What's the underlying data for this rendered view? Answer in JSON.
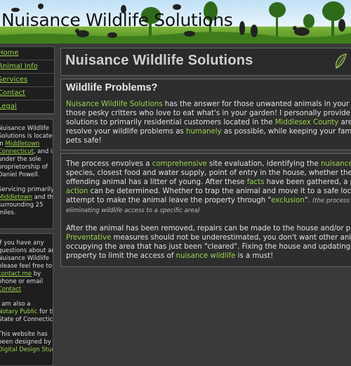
{
  "banner": {
    "title": "Nuisance Wildlife Solutions"
  },
  "nav": {
    "items": [
      {
        "label": "Home"
      },
      {
        "label": "Animal Info"
      },
      {
        "label": "Services"
      },
      {
        "label": "Contact"
      },
      {
        "label": "Legal"
      }
    ]
  },
  "sidebar": {
    "about": {
      "l1a": "Nuisance Wildlife",
      "l2a": "Solutions is located",
      "l3a": "in ",
      "l3b": "Middletown",
      "l4a": "Connecticut",
      "l4b": ", and is",
      "l5a": "under the sole",
      "l6a": "proprietorship of",
      "l7a": "Daniel Powell.",
      "m1": "Servicing primarily",
      "m2a": "Middletown",
      "m2b": " and the",
      "m3": "surrounding 25",
      "m4": "miles."
    },
    "contact": {
      "l1": "If you have any",
      "l2": "questions about any",
      "l3": "Nuisance Wildlife",
      "l4": "please feel free to",
      "l5a": "contact me",
      "l5b": " by",
      "l6": "phone or email",
      "l7": "Contact",
      "n1": "I am also a",
      "n2a": "Notary Public",
      "n2b": " for the",
      "n3": "State of Connecticut.",
      "d1": "This website has",
      "d2": "been designed by",
      "d3": "Digital Design Studio"
    }
  },
  "main": {
    "page_title": "Nuisance Wildlife Solutions",
    "section1": {
      "heading": "Wildlife Problems?",
      "p1_link1": "Nuisance Wildlife Solutions",
      "p1_t1": " has the answer for those unwanted animals in your house,",
      "p1_t2": "those pesky critters who love to eat what's in your garden! I personally provide",
      "p1_t3": "solutions to primarily residential customers located in the ",
      "p1_link2": "Middlesex County",
      "p1_t4": " area. I",
      "p1_t5": "resolve your wildlife problems as ",
      "p1_link3": "humanely",
      "p1_t6": " as possible, while keeping your family and",
      "p1_t7": "pets safe!"
    },
    "section2": {
      "a1": "The process envolves a ",
      "a1_link": "comprehensive",
      "a2": " site evaluation, identifying the ",
      "a2_link": "nuisance wildlife",
      "b1": "species, closest food and water supply, point of entry in the house, whether the",
      "c1": "offending animal has a litter of young. After these ",
      "c1_link": "facts",
      "c2": " have been gathered, a plan of",
      "d1_link": "action",
      "d2": " can be determined. Whether to trap the animal and move it to a safe location or",
      "e1": "attempt to make the animal leave the property through \"",
      "e1_link": "exclusion",
      "e2": "\". ",
      "e3_note": "(the process of",
      "f1_note": "eliminating wildlife access to a specific area)",
      "g1": "After the animal has been removed, repairs can be made to the house and/or property.",
      "h1_link": "Preventative",
      "h2": " measures should not be underestimated, you don't want other animals",
      "i1": "occupying the area that has just been \"cleared\". Fixing the house and updating the",
      "j1": "property to limit the access of ",
      "j1_link": "nuisance wildlife",
      "j2": " is a must!"
    }
  }
}
